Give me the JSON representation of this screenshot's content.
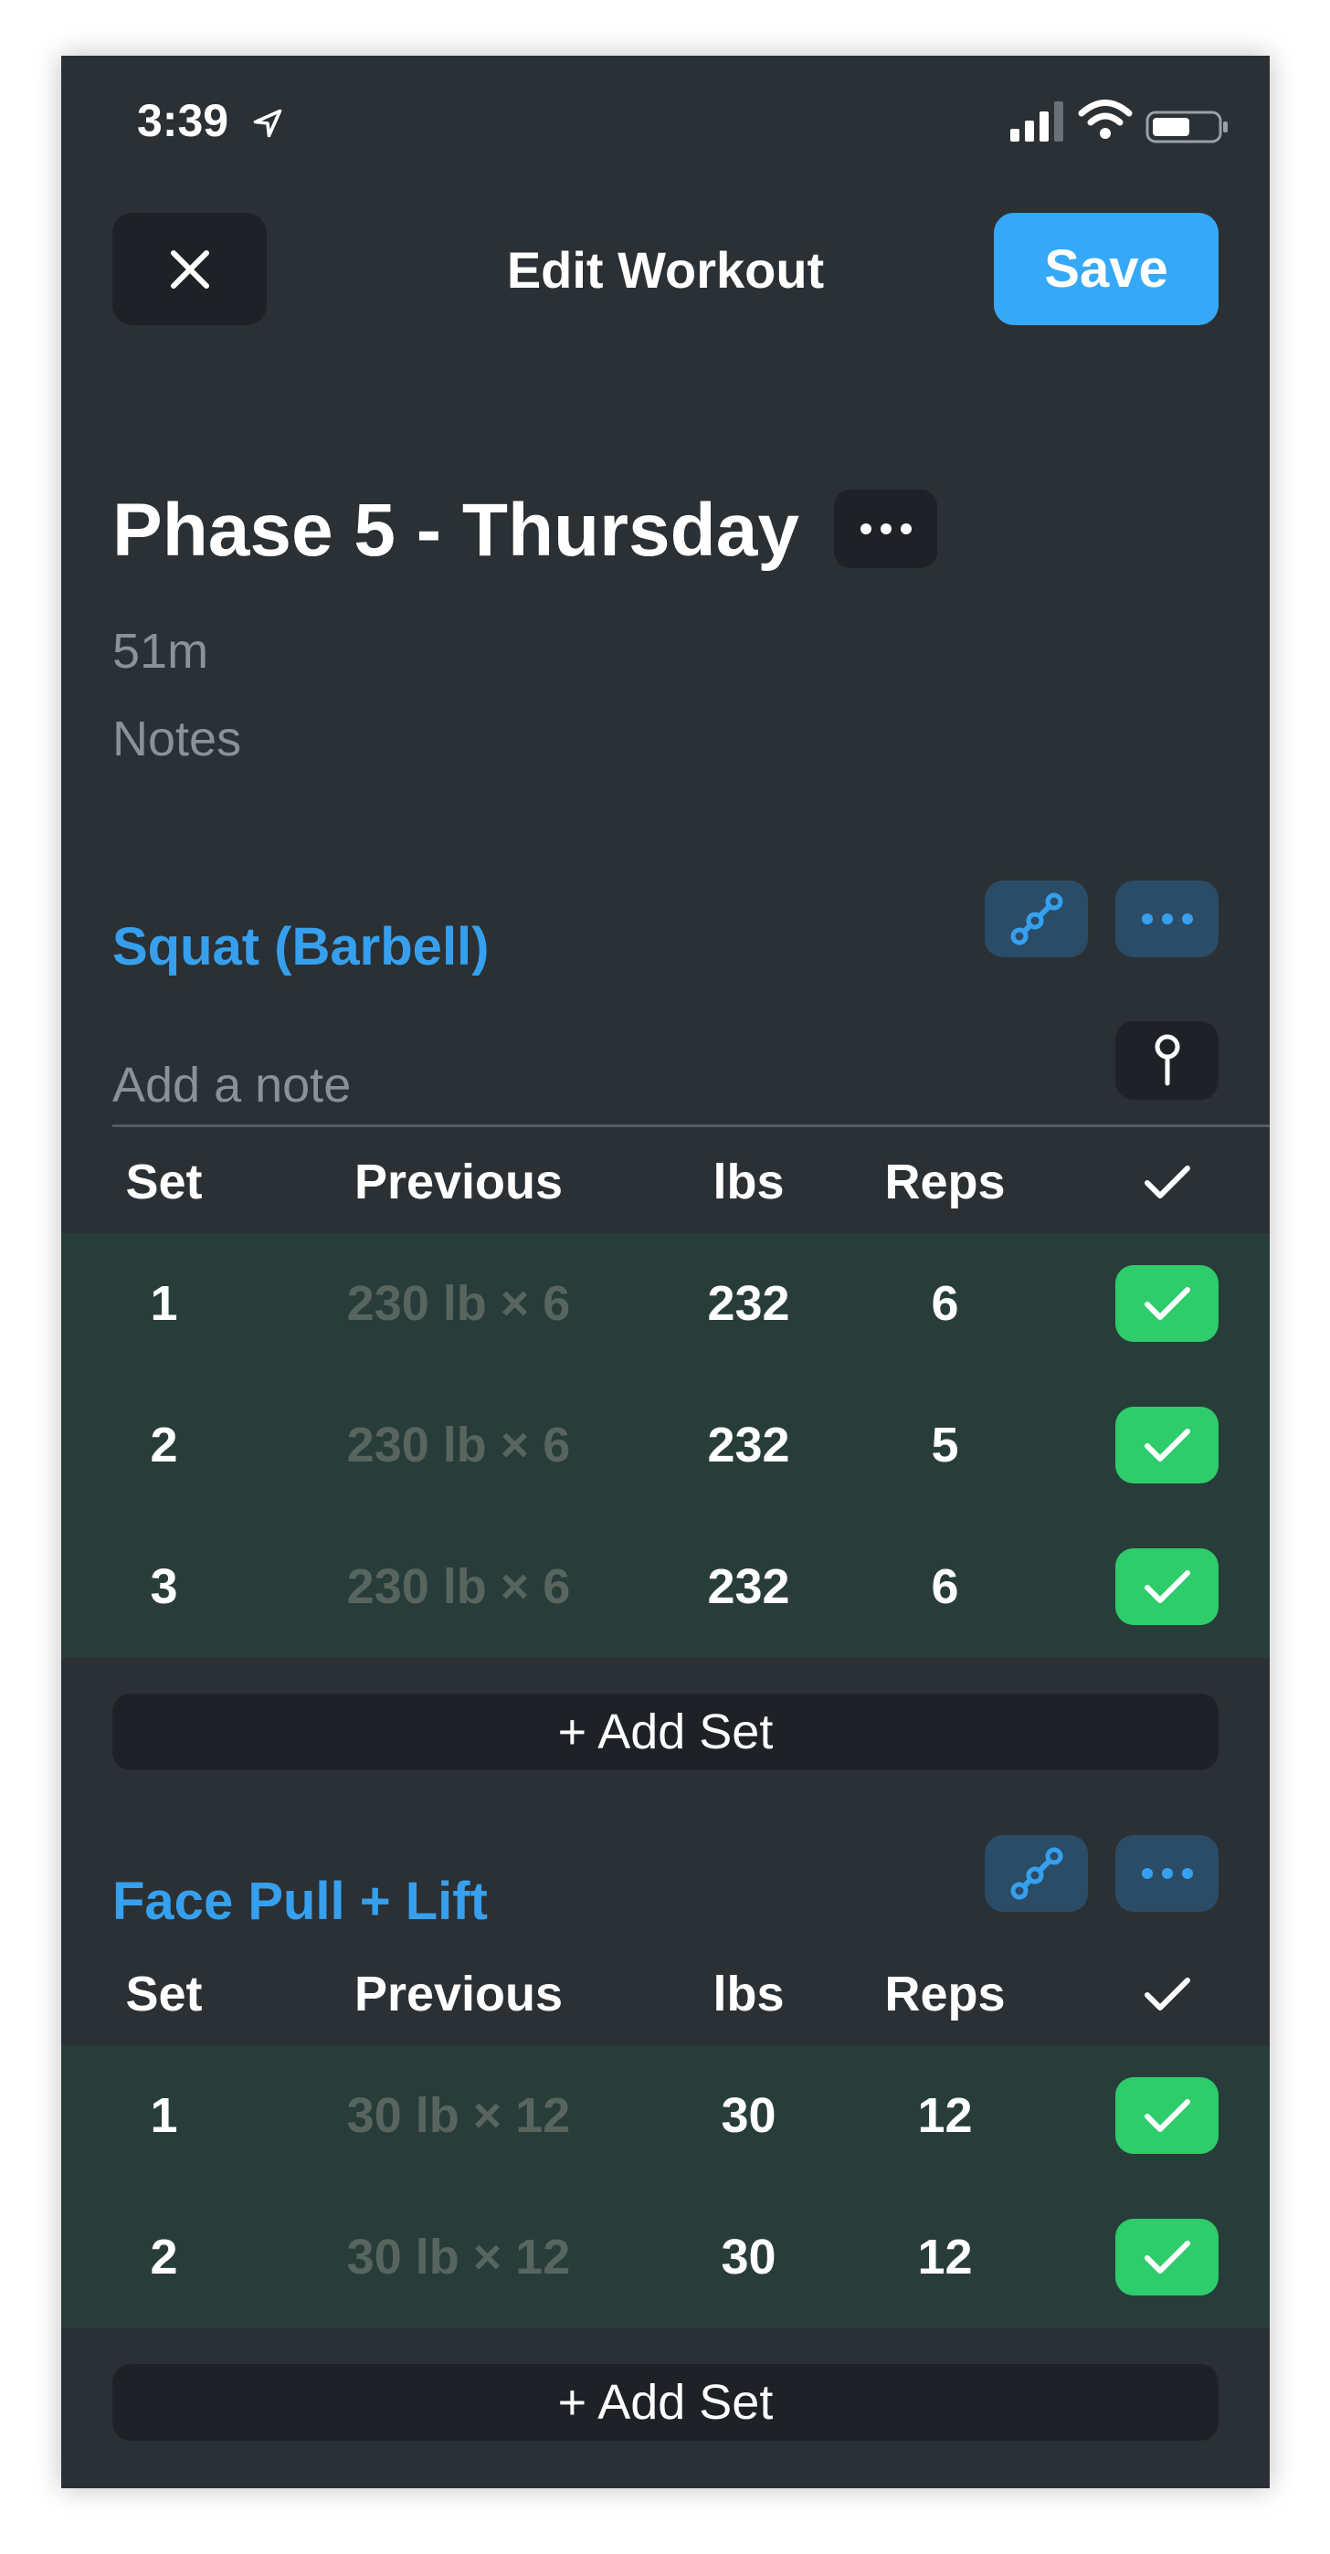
{
  "status_bar": {
    "time": "3:39"
  },
  "header": {
    "title": "Edit Workout",
    "save_label": "Save"
  },
  "workout": {
    "title": "Phase 5 - Thursday",
    "duration": "51m",
    "notes_placeholder": "Notes"
  },
  "table_headers": {
    "set": "Set",
    "previous": "Previous",
    "weight": "lbs",
    "reps": "Reps"
  },
  "exercises": [
    {
      "name": "Squat (Barbell)",
      "note_placeholder": "Add a note",
      "sets": [
        {
          "set": "1",
          "previous": "230 lb × 6",
          "weight": "232",
          "reps": "6",
          "completed": true
        },
        {
          "set": "2",
          "previous": "230 lb × 6",
          "weight": "232",
          "reps": "5",
          "completed": true
        },
        {
          "set": "3",
          "previous": "230 lb × 6",
          "weight": "232",
          "reps": "6",
          "completed": true
        }
      ],
      "add_set_label": "+ Add Set"
    },
    {
      "name": "Face Pull + Lift",
      "sets": [
        {
          "set": "1",
          "previous": "30 lb × 12",
          "weight": "30",
          "reps": "12",
          "completed": true
        },
        {
          "set": "2",
          "previous": "30 lb × 12",
          "weight": "30",
          "reps": "12",
          "completed": true
        }
      ],
      "add_set_label": "+ Add Set"
    }
  ],
  "icons": {
    "close": "close-icon",
    "more": "ellipsis-icon",
    "chart": "progress-chart-icon",
    "pin": "pin-icon",
    "check": "checkmark-icon",
    "location": "location-arrow-icon",
    "signal": "signal-icon",
    "wifi": "wifi-icon",
    "battery": "battery-icon"
  },
  "colors": {
    "background": "#2a3034",
    "accent": "#36a8f8",
    "exercise_name": "#36a0ee",
    "completed_row": "#283d3a",
    "check_green": "#2ecc6a",
    "icon_button": "#2b4c67"
  }
}
